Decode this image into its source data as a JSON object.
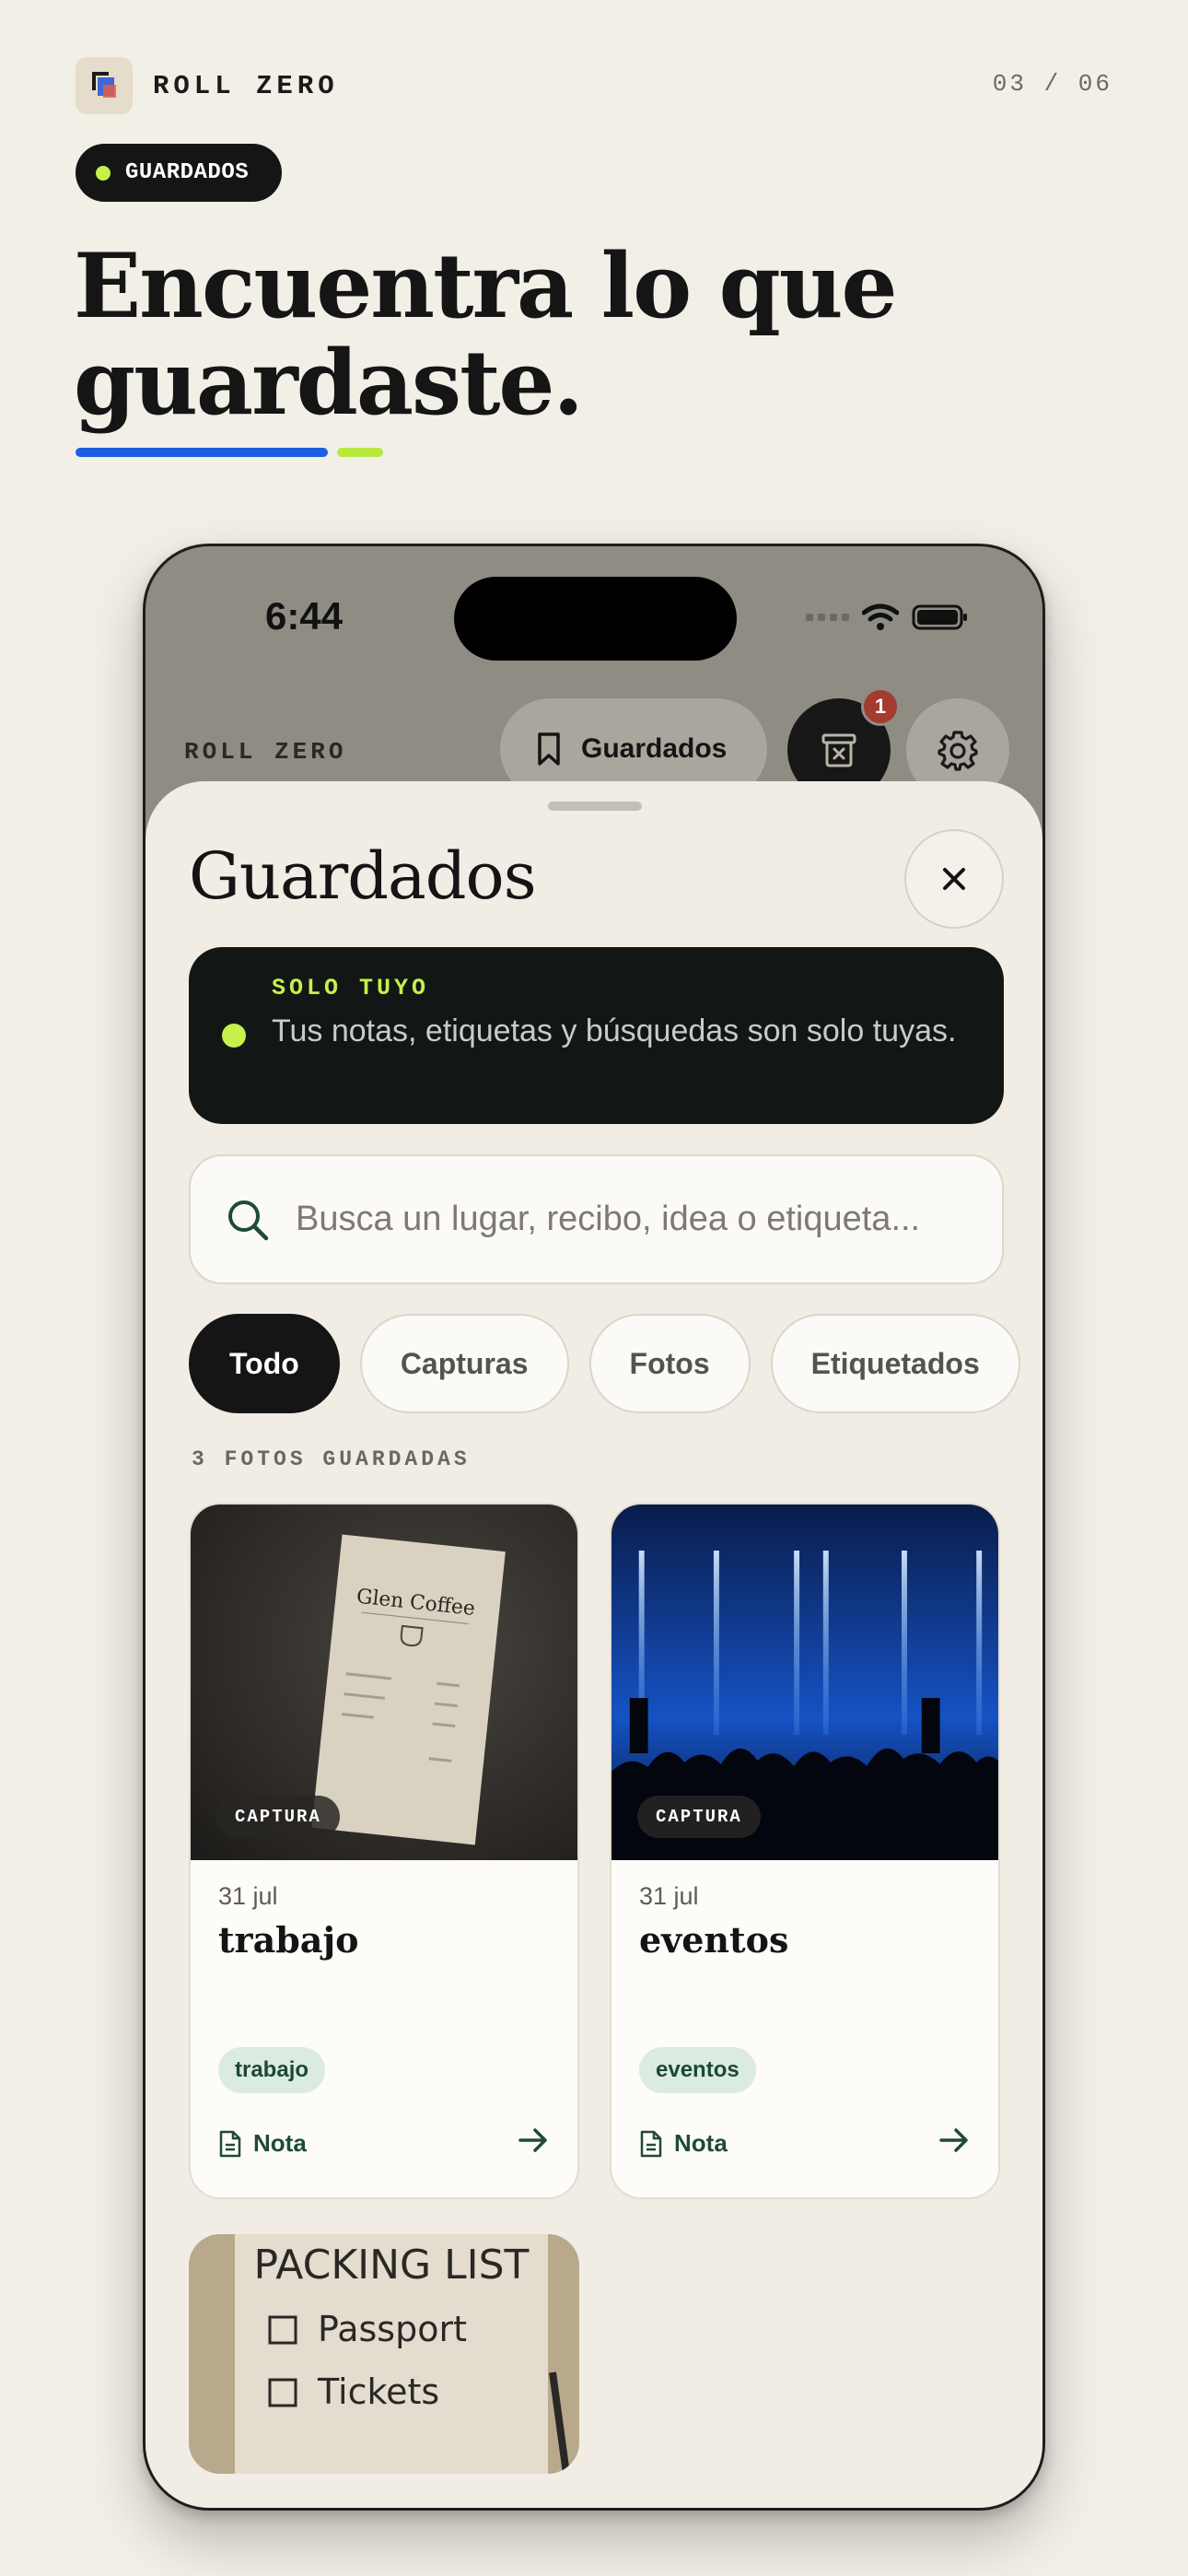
{
  "header": {
    "brand": "ROLL ZERO",
    "pager": "03 / 06",
    "section_pill": "GUARDADOS",
    "headline_line1": "Encuentra lo que",
    "headline_line2": "guardaste.",
    "colors": {
      "accent_blue": "#1d5de0",
      "accent_lime": "#c6f04a"
    }
  },
  "phone": {
    "status_time": "6:44",
    "app_brand": "ROLL ZERO",
    "saved_tab_label": "Guardados",
    "trash_badge_count": "1",
    "sheet": {
      "title": "Guardados",
      "privacy_kicker": "SOLO TUYO",
      "privacy_text": "Tus notas, etiquetas y búsquedas son solo tuyas.",
      "search_placeholder": "Busca un lugar, recibo, idea o etiqueta...",
      "filters": [
        "Todo",
        "Capturas",
        "Fotos",
        "Etiquetados"
      ],
      "active_filter": "Todo",
      "count_label": "3 FOTOS GUARDADAS",
      "cards": [
        {
          "type": "CAPTURA",
          "date": "31 jul",
          "title": "trabajo",
          "tag": "trabajo",
          "note_label": "Nota",
          "image": "receipt-photo",
          "image_text": "Glen Coffee"
        },
        {
          "type": "CAPTURA",
          "date": "31 jul",
          "title": "eventos",
          "tag": "eventos",
          "note_label": "Nota",
          "image": "concert-photo"
        }
      ],
      "partial_card": {
        "image": "packing-list-photo",
        "image_title": "PACKING LIST",
        "image_items": [
          "Passport",
          "Tickets"
        ]
      }
    }
  }
}
